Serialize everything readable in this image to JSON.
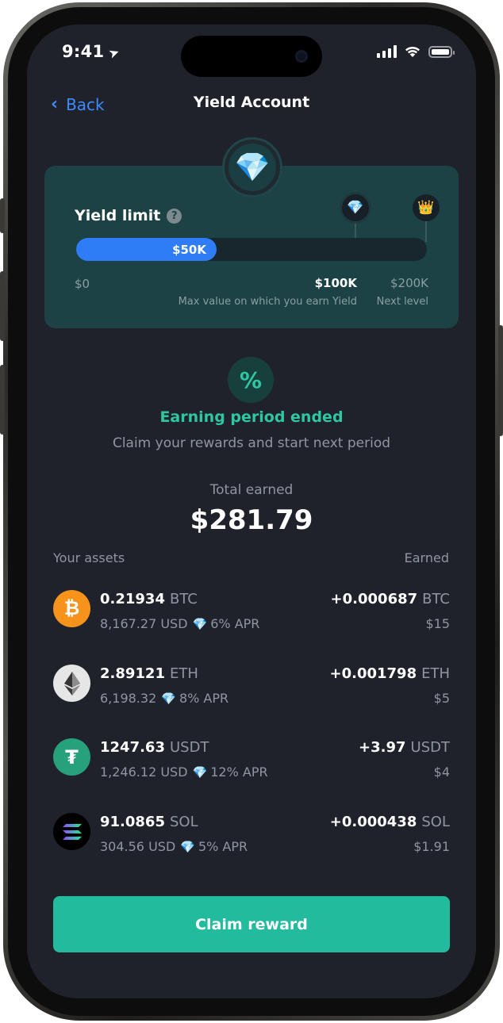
{
  "status_bar": {
    "time": "9:41"
  },
  "nav": {
    "back_label": "Back",
    "title": "Yield Account"
  },
  "yield_card": {
    "title": "Yield limit",
    "help_glyph": "?",
    "progress_label": "$50K",
    "progress_fraction": 0.5,
    "min_label": "$0",
    "current_label": "$100K",
    "current_caption": "Max value on which you earn Yield",
    "next_label": "$200K",
    "next_caption": "Next level",
    "tier_icons": [
      "diamond-icon",
      "crown-icon"
    ]
  },
  "earning": {
    "icon": "percent-icon",
    "percent_glyph": "%",
    "title": "Earning period ended",
    "subtitle": "Claim your rewards and start next period",
    "total_label": "Total earned",
    "total_value": "$281.79"
  },
  "assets_header": {
    "left": "Your assets",
    "right": "Earned"
  },
  "assets": [
    {
      "name": "bitcoin",
      "amount": "0.21934",
      "symbol": "BTC",
      "usd": "8,167.27 USD",
      "apr": "6% APR",
      "earned": "+0.000687",
      "earned_symbol": "BTC",
      "earned_usd": "$15",
      "color": "#f7931a"
    },
    {
      "name": "ethereum",
      "amount": "2.89121",
      "symbol": "ETH",
      "usd": "6,198.32",
      "apr": "8% APR",
      "earned": "+0.001798",
      "earned_symbol": "ETH",
      "earned_usd": "$5",
      "color": "#e6e6e6"
    },
    {
      "name": "tether",
      "amount": "1247.63",
      "symbol": "USDT",
      "usd": "1,246.12 USD",
      "apr": "12% APR",
      "earned": "+3.97",
      "earned_symbol": "USDT",
      "earned_usd": "$4",
      "color": "#26a17b"
    },
    {
      "name": "solana",
      "amount": "91.0865",
      "symbol": "SOL",
      "usd": "304.56 USD",
      "apr": "5% APR",
      "earned": "+0.000438",
      "earned_symbol": "SOL",
      "earned_usd": "$1.91",
      "color": "#000000"
    }
  ],
  "claim_button": {
    "label": "Claim reward"
  },
  "colors": {
    "accent": "#22bb9d",
    "link": "#3d8bff",
    "progress": "#2f7df6",
    "background": "#1f222b",
    "card": "#1c4245"
  }
}
